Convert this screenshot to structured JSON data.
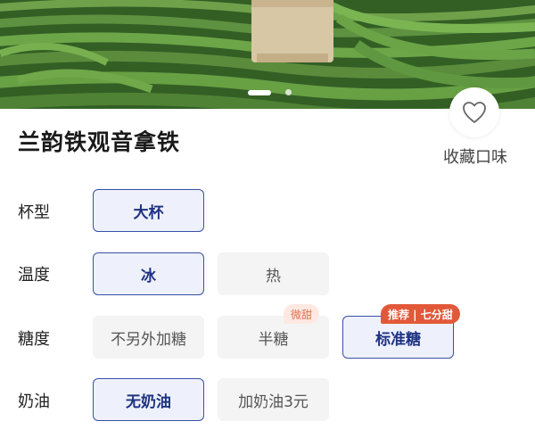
{
  "product": {
    "title": "兰韵铁观音拿铁"
  },
  "favorite": {
    "label": "收藏口味",
    "icon": "heart-outline-icon"
  },
  "carousel": {
    "total_slides": 2,
    "active_slide": 1
  },
  "colors": {
    "selected_border": "#3a4fa6",
    "selected_text": "#1e3282",
    "selected_bg": "#eef1fb",
    "badge_accent": "#e2593a"
  },
  "options": {
    "cup": {
      "label": "杯型",
      "choices": [
        {
          "text": "大杯",
          "selected": true
        }
      ]
    },
    "temperature": {
      "label": "温度",
      "choices": [
        {
          "text": "冰",
          "selected": true
        },
        {
          "text": "热",
          "selected": false
        }
      ]
    },
    "sugar": {
      "label": "糖度",
      "choices": [
        {
          "text": "不另外加糖",
          "selected": false
        },
        {
          "text": "半糖",
          "selected": false,
          "badge": "微甜"
        },
        {
          "text": "标准糖",
          "selected": true,
          "badge": "推荐 | 七分甜"
        }
      ]
    },
    "cream": {
      "label": "奶油",
      "choices": [
        {
          "text": "无奶油",
          "selected": true
        },
        {
          "text": "加奶油3元",
          "selected": false
        }
      ]
    }
  }
}
